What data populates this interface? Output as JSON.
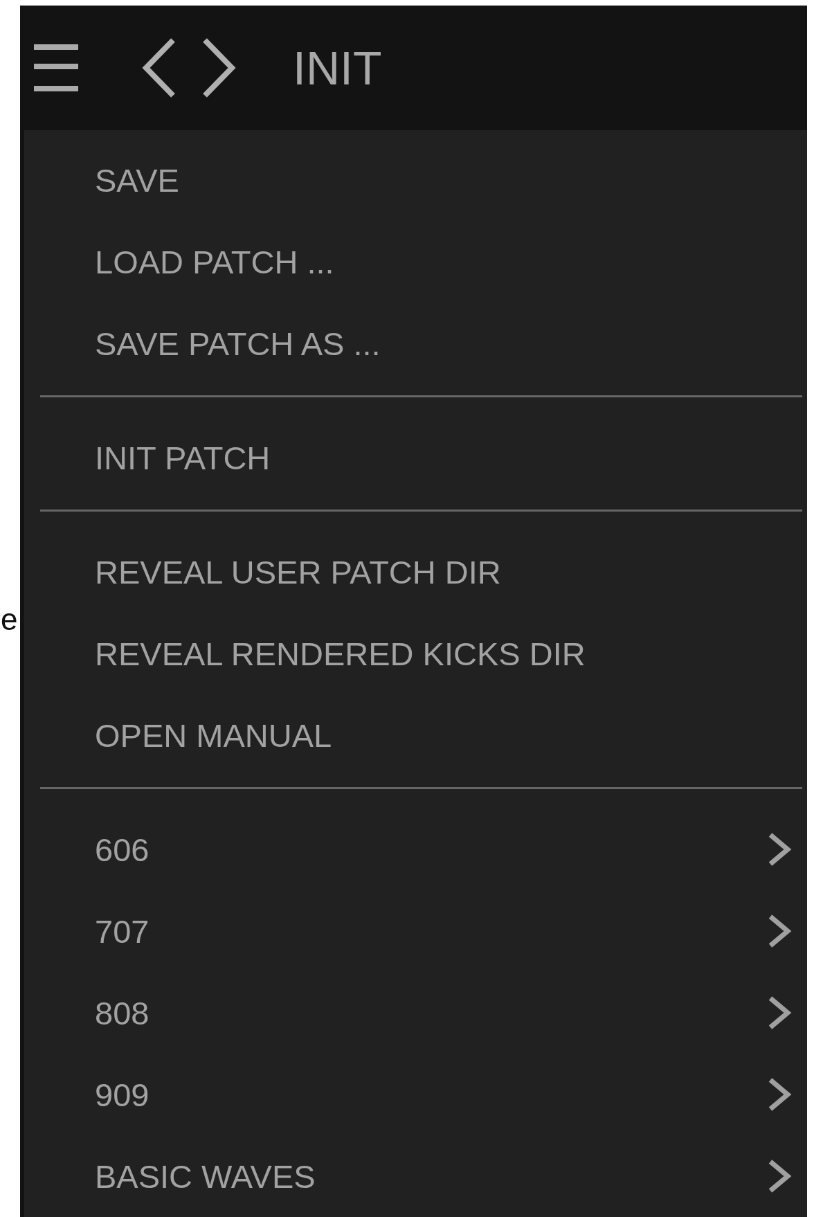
{
  "background": {
    "text_fragment": "e"
  },
  "header": {
    "title": "INIT"
  },
  "menu": {
    "sections": [
      {
        "items": [
          {
            "label": "SAVE",
            "submenu": false
          },
          {
            "label": "LOAD PATCH ...",
            "submenu": false
          },
          {
            "label": "SAVE PATCH AS ...",
            "submenu": false
          }
        ]
      },
      {
        "items": [
          {
            "label": "INIT PATCH",
            "submenu": false
          }
        ]
      },
      {
        "items": [
          {
            "label": "REVEAL USER PATCH DIR",
            "submenu": false
          },
          {
            "label": "REVEAL RENDERED KICKS DIR",
            "submenu": false
          },
          {
            "label": "OPEN MANUAL",
            "submenu": false
          }
        ]
      },
      {
        "items": [
          {
            "label": "606",
            "submenu": true
          },
          {
            "label": "707",
            "submenu": true
          },
          {
            "label": "808",
            "submenu": true
          },
          {
            "label": "909",
            "submenu": true
          },
          {
            "label": "BASIC WAVES",
            "submenu": true
          }
        ]
      }
    ]
  }
}
